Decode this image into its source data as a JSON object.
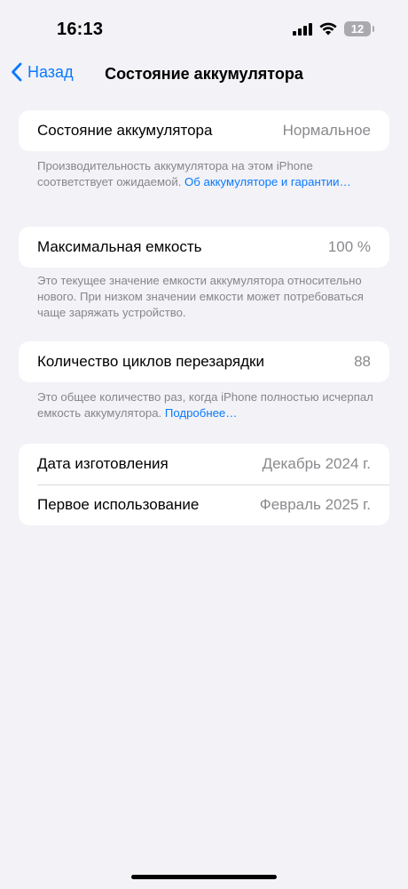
{
  "status_bar": {
    "time": "16:13",
    "battery_level": "12",
    "icons": [
      "cellular-signal-icon",
      "wifi-icon",
      "battery-icon"
    ]
  },
  "nav": {
    "back_label": "Назад",
    "title": "Состояние аккумулятора"
  },
  "battery_health": {
    "label": "Состояние аккумулятора",
    "value": "Нормальное",
    "footnote_text": "Производительность аккумулятора на этом iPhone соответствует ожидаемой. ",
    "footnote_link": "Об аккумуляторе и гаран­тии…"
  },
  "max_capacity": {
    "label": "Максимальная емкость",
    "value": "100 %",
    "footnote_text": "Это текущее значение емкости аккумулятора относительно нового. При низком значении емкости может потребоваться чаще заряжать устройство."
  },
  "cycle_count": {
    "label": "Количество циклов перезарядки",
    "value": "88",
    "footnote_text": "Это общее количество раз, когда iPhone полностью исчерпал емкость аккумулятора. ",
    "footnote_link": "Подробнее…"
  },
  "dates": {
    "manufacture_label": "Дата изготовления",
    "manufacture_value": "Декабрь 2024 г.",
    "first_use_label": "Первое использование",
    "first_use_value": "Февраль 2025 г."
  },
  "colors": {
    "accent": "#0a7aff",
    "background": "#f2f2f7",
    "secondary_text": "#8a8a8e"
  }
}
